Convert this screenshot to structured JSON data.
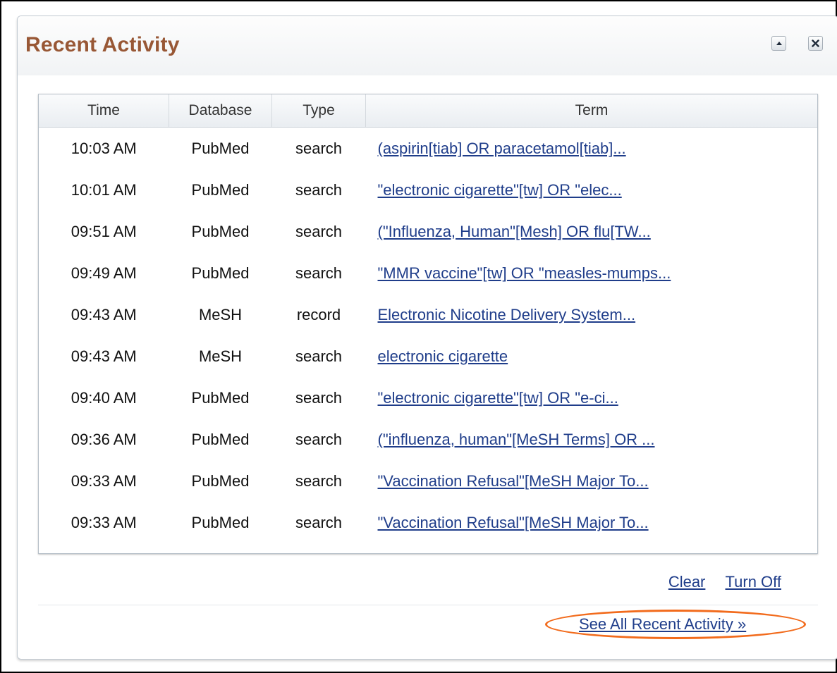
{
  "panel": {
    "title": "Recent Activity"
  },
  "table": {
    "headers": [
      "Time",
      "Database",
      "Type",
      "Term"
    ],
    "rows": [
      {
        "time": "10:03 AM",
        "database": "PubMed",
        "type": "search",
        "term": "(aspirin[tiab] OR paracetamol[tiab]..."
      },
      {
        "time": "10:01 AM",
        "database": "PubMed",
        "type": "search",
        "term": "\"electronic cigarette\"[tw] OR \"elec..."
      },
      {
        "time": "09:51 AM",
        "database": "PubMed",
        "type": "search",
        "term": "(\"Influenza, Human\"[Mesh] OR flu[TW..."
      },
      {
        "time": "09:49 AM",
        "database": "PubMed",
        "type": "search",
        "term": "\"MMR vaccine\"[tw] OR \"measles-mumps..."
      },
      {
        "time": "09:43 AM",
        "database": "MeSH",
        "type": "record",
        "term": "Electronic Nicotine Delivery System..."
      },
      {
        "time": "09:43 AM",
        "database": "MeSH",
        "type": "search",
        "term": "electronic cigarette"
      },
      {
        "time": "09:40 AM",
        "database": "PubMed",
        "type": "search",
        "term": "\"electronic cigarette\"[tw] OR \"e-ci..."
      },
      {
        "time": "09:36 AM",
        "database": "PubMed",
        "type": "search",
        "term": "(\"influenza, human\"[MeSH Terms] OR ..."
      },
      {
        "time": "09:33 AM",
        "database": "PubMed",
        "type": "search",
        "term": "\"Vaccination Refusal\"[MeSH Major To..."
      },
      {
        "time": "09:33 AM",
        "database": "PubMed",
        "type": "search",
        "term": "\"Vaccination Refusal\"[MeSH Major To..."
      }
    ]
  },
  "actions": {
    "clear_label": "Clear",
    "turn_off_label": "Turn Off"
  },
  "footer": {
    "see_all_label": "See All Recent Activity »"
  },
  "icons": {
    "collapse": "collapse-up-icon",
    "close": "close-icon"
  },
  "colors": {
    "title": "#985735",
    "link": "#1f3d8a",
    "highlight": "#f26b1c"
  }
}
